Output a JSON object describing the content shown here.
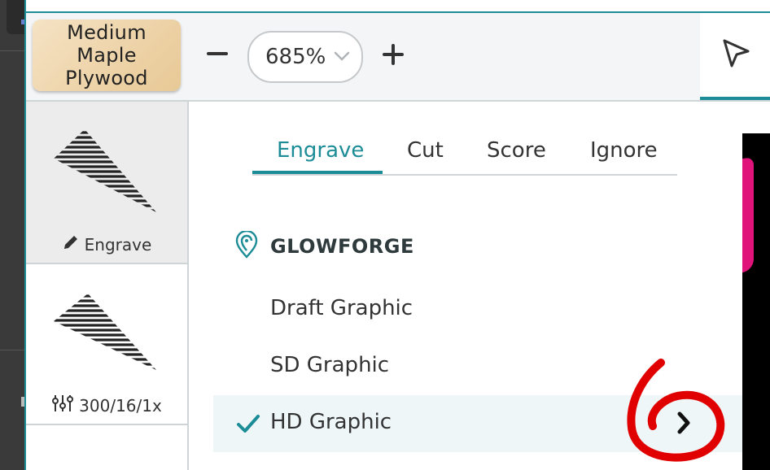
{
  "material": {
    "name": "Medium\nMaple\nPlywood"
  },
  "zoom": {
    "value": "685%"
  },
  "steps": [
    {
      "label": "Engrave",
      "icon": "pencil-icon"
    },
    {
      "label": "300/16/1x",
      "icon": "sliders-icon"
    }
  ],
  "tabs": [
    {
      "label": "Engrave",
      "active": true
    },
    {
      "label": "Cut"
    },
    {
      "label": "Score"
    },
    {
      "label": "Ignore"
    }
  ],
  "brand": {
    "name": "GLOWFORGE"
  },
  "presets": [
    {
      "label": "Draft Graphic"
    },
    {
      "label": "SD Graphic"
    },
    {
      "label": "HD Graphic",
      "selected": true
    }
  ],
  "colors": {
    "accent": "#1c8c97",
    "annotation": "#e00000",
    "preview_highlight": "#e0137a"
  }
}
